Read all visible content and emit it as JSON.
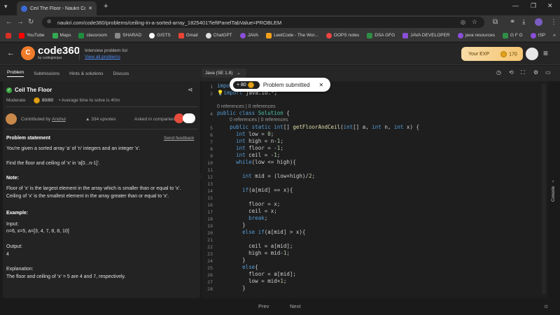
{
  "browser": {
    "tab_title": "Ceil The Floor - Naukri Code 36",
    "url": "naukri.com/code360/problems/ceiling-in-a-sorted-array_1825401?leftPanelTabValue=PROBLEM",
    "bookmarks": [
      "YouTube",
      "Maps",
      "classroom",
      "SHARAD",
      "GISTS",
      "Gmail",
      "ChatGPT",
      "JAVA",
      "LeetCode - The Wor...",
      "OOPS notes",
      "DSA GFG",
      "JAVA DEVELOPER",
      "java resources",
      "G F G",
      "ISP"
    ]
  },
  "header": {
    "logo_num": "code360",
    "logo_sub": "by codingninjas",
    "problem_list_label": "Interview problem list",
    "view_all": "View all problems",
    "exp_label": "Your EXP",
    "exp_value": "170"
  },
  "left_tabs": [
    "Problem",
    "Submissions",
    "Hints & solutions",
    "Discuss"
  ],
  "problem": {
    "title": "Ceil The Floor",
    "difficulty": "Moderate",
    "score": "80/80",
    "avg_time": "Average time to solve is 40m",
    "contributed_by_label": "Contributed by",
    "contributor": "Anshul",
    "upvotes": "334 upvotes",
    "asked_in": "Asked in companies",
    "statement_heading": "Problem statement",
    "send_feedback": "Send feedback",
    "statement_1": "You're given a sorted array 'a' of 'n' integers and an integer 'x'.",
    "statement_2": "Find the floor and ceiling of 'x' in 'a[0...n-1]'.",
    "note_heading": "Note:",
    "note_1": "Floor of 'x' is the largest element in the array which is smaller than or equal to 'x'.",
    "note_2": "Ceiling of 'x' is the smallest element in the array greater than or equal to 'x'.",
    "example_heading": "Example:",
    "input_label": "Input:",
    "input_value": "n=6, x=5, a=[3, 4, 7, 8, 8, 10]",
    "output_label": "Output:",
    "output_value": "4",
    "explanation_label": "Explanation:",
    "explanation_value": "The floor and ceiling of 'x' = 5 are 4 and 7, respectively."
  },
  "editor": {
    "language": "Java (SE 1.8)",
    "toast_points": "+ 80",
    "toast_text": "Problem submitted",
    "references": "0 references | 0 references"
  },
  "footer": {
    "prev": "Prev",
    "next": "Next"
  },
  "console_label": "Console"
}
